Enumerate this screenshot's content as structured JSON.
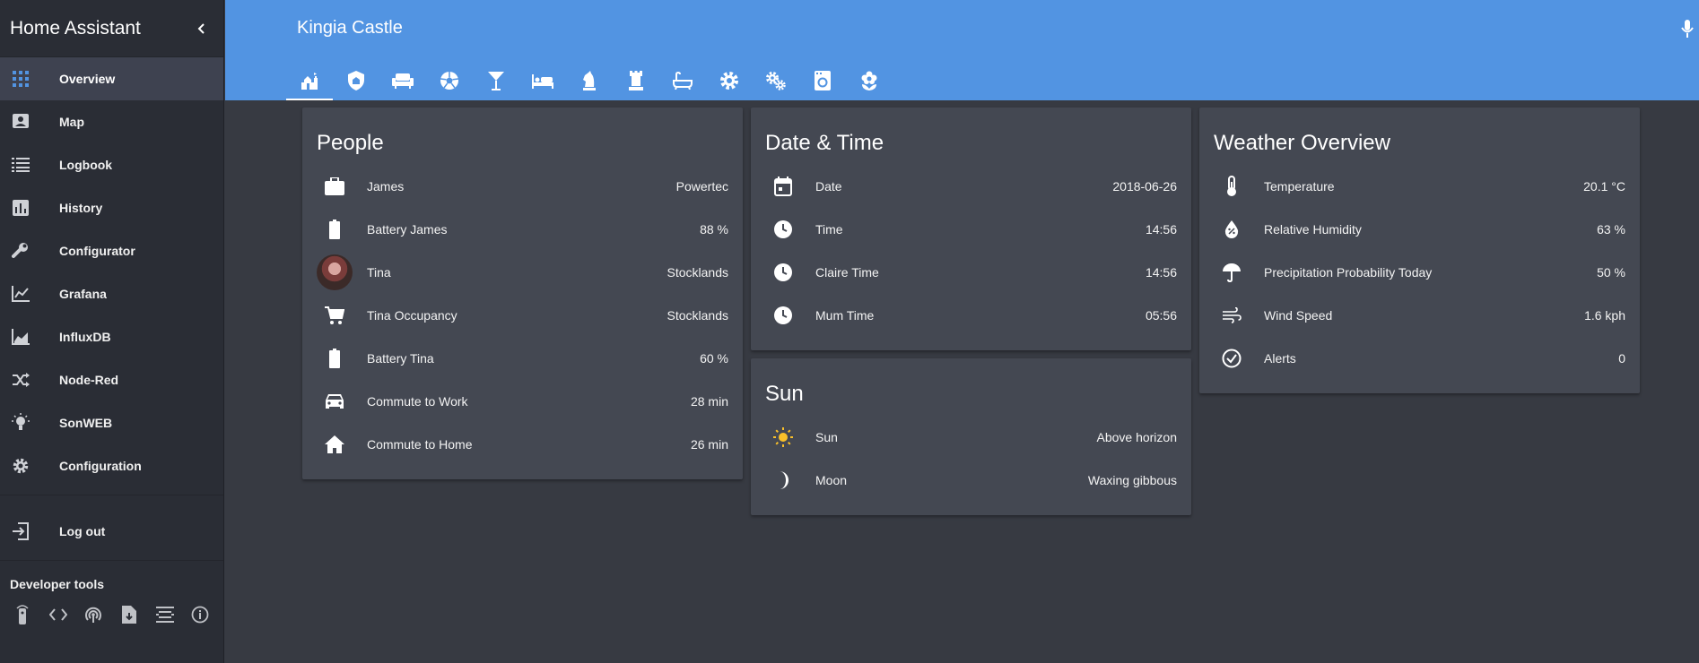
{
  "sidebar": {
    "title": "Home Assistant",
    "items": [
      {
        "label": "Overview",
        "icon": "overview-grid-icon"
      },
      {
        "label": "Map",
        "icon": "map-icon"
      },
      {
        "label": "Logbook",
        "icon": "logbook-icon"
      },
      {
        "label": "History",
        "icon": "history-chart-icon"
      },
      {
        "label": "Configurator",
        "icon": "wrench-icon"
      },
      {
        "label": "Grafana",
        "icon": "grafana-chart-icon"
      },
      {
        "label": "InfluxDB",
        "icon": "influxdb-chart-icon"
      },
      {
        "label": "Node-Red",
        "icon": "shuffle-icon"
      },
      {
        "label": "SonWEB",
        "icon": "lightbulb-icon"
      },
      {
        "label": "Configuration",
        "icon": "gear-icon"
      }
    ],
    "logout": "Log out",
    "dev_tools_title": "Developer tools",
    "dev_tools": [
      "remote-icon",
      "code-icon",
      "antenna-icon",
      "file-download-icon",
      "template-icon",
      "info-icon"
    ]
  },
  "header": {
    "title": "Kingia Castle",
    "tabs": [
      "castle-icon",
      "shield-home-icon",
      "sofa-icon",
      "soccer-icon",
      "glass-cocktail-icon",
      "bed-icon",
      "chess-knight-icon",
      "chess-rook-icon",
      "bathtub-icon",
      "gear-icon",
      "gears-icon",
      "washing-machine-icon",
      "flower-icon"
    ]
  },
  "cards": {
    "people": {
      "title": "People",
      "rows": [
        {
          "name": "James",
          "value": "Powertec"
        },
        {
          "name": "Battery James",
          "value": "88 %"
        },
        {
          "name": "Tina",
          "value": "Stocklands"
        },
        {
          "name": "Tina Occupancy",
          "value": "Stocklands"
        },
        {
          "name": "Battery Tina",
          "value": "60 %"
        },
        {
          "name": "Commute to Work",
          "value": "28 min"
        },
        {
          "name": "Commute to Home",
          "value": "26 min"
        }
      ]
    },
    "datetime": {
      "title": "Date & Time",
      "rows": [
        {
          "name": "Date",
          "value": "2018-06-26"
        },
        {
          "name": "Time",
          "value": "14:56"
        },
        {
          "name": "Claire Time",
          "value": "14:56"
        },
        {
          "name": "Mum Time",
          "value": "05:56"
        }
      ]
    },
    "sun": {
      "title": "Sun",
      "rows": [
        {
          "name": "Sun",
          "value": "Above horizon"
        },
        {
          "name": "Moon",
          "value": "Waxing gibbous"
        }
      ]
    },
    "weather": {
      "title": "Weather Overview",
      "rows": [
        {
          "name": "Temperature",
          "value": "20.1 °C"
        },
        {
          "name": "Relative Humidity",
          "value": "63 %"
        },
        {
          "name": "Precipitation Probability Today",
          "value": "50 %"
        },
        {
          "name": "Wind Speed",
          "value": "1.6 kph"
        },
        {
          "name": "Alerts",
          "value": "0"
        }
      ]
    }
  },
  "colors": {
    "header": "#5294e2",
    "sidebar": "#2a2d35",
    "card": "#444852",
    "background": "#373a42",
    "sun_icon": "#f9c02a",
    "active_icon": "#5294e2"
  }
}
